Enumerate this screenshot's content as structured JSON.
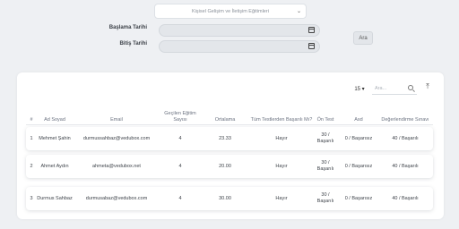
{
  "filters": {
    "course_select": "Kişisel Gelişim ve İletişim Eğitimleri",
    "start_label": "Başlama Tarihi",
    "end_label": "Bitiş Tarihi",
    "search_button": "Ara"
  },
  "toolbar": {
    "page_size": "15 ▾",
    "search_placeholder": "Ara...",
    "export_icon": "upload-icon"
  },
  "table": {
    "headers": [
      "#",
      "Ad Soyad",
      "Email",
      "Geçilen Eğitim Sayısı",
      "Ortalama",
      "Tüm Testlerden Başarılı Mı?",
      "Ön Test",
      "Asd",
      "Değerlendirme Sınavı"
    ],
    "rows": [
      [
        "1",
        "Mehmet Şahin",
        "durmussahbaz@vedubox.com",
        "4",
        "23.33",
        "Hayır",
        "30 / Başarılı",
        "0 / Başarısız",
        "40 / Başarılı"
      ],
      [
        "2",
        "Ahmet Aydın",
        "ahmeta@vedubox.net",
        "4",
        "20.00",
        "Hayır",
        "30 / Başarılı",
        "0 / Başarısız",
        "40 / Başarılı"
      ],
      [
        "3",
        "Durmus Sahbaz",
        "durmusabaz@vedubox.com",
        "4",
        "30.00",
        "Hayır",
        "30 / Başarılı",
        "0 / Başarısız",
        "40 / Başarılı"
      ]
    ]
  }
}
